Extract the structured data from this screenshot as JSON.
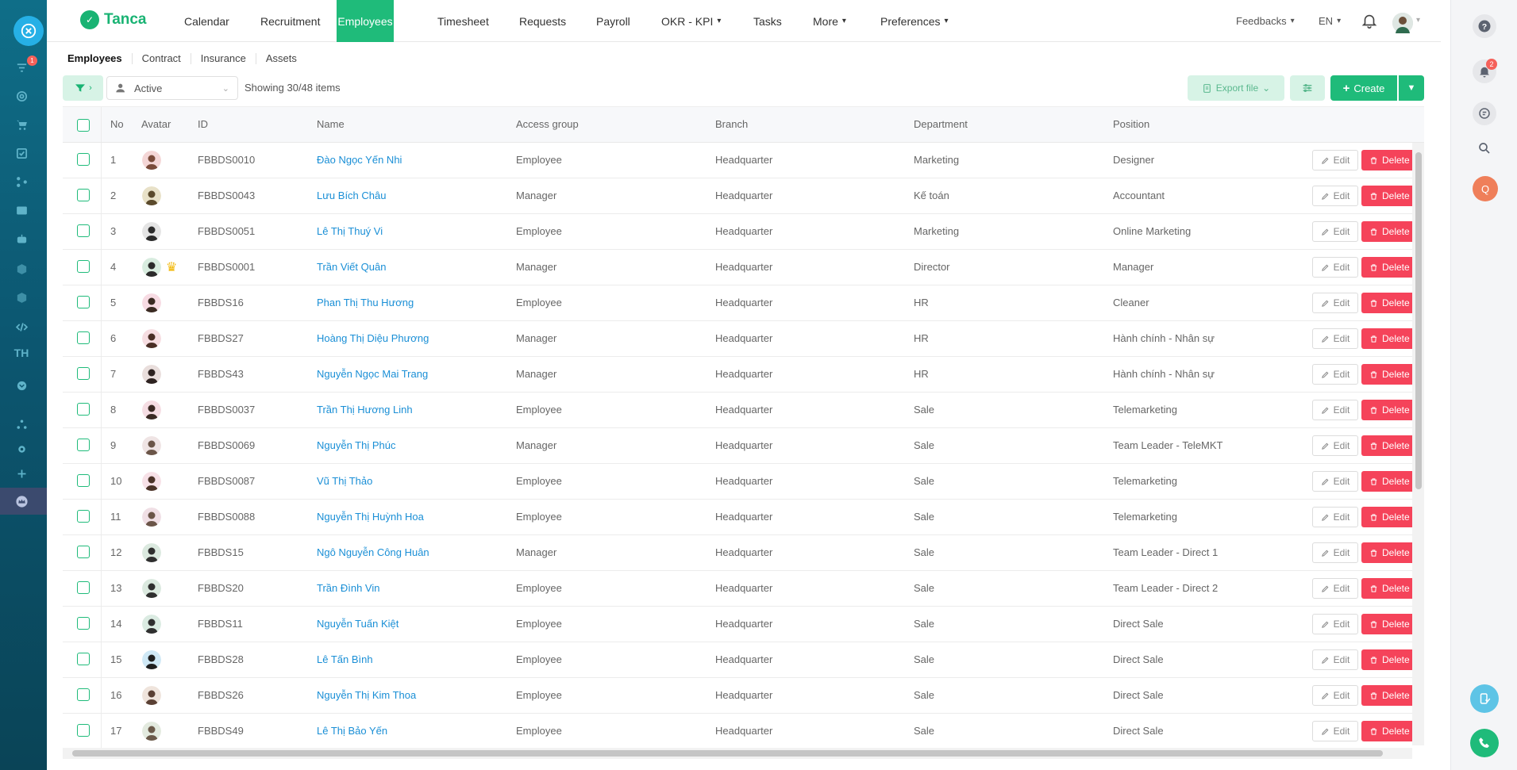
{
  "app": {
    "logo_text": "Tanca"
  },
  "nav": {
    "items": [
      {
        "label": "Calendar"
      },
      {
        "label": "Recruitment"
      },
      {
        "label": "Employees",
        "active": true
      },
      {
        "label": "Timesheet"
      },
      {
        "label": "Requests"
      },
      {
        "label": "Payroll"
      },
      {
        "label": "OKR - KPI",
        "dropdown": true
      },
      {
        "label": "Tasks"
      },
      {
        "label": "More",
        "dropdown": true
      },
      {
        "label": "Preferences",
        "dropdown": true
      }
    ],
    "feedbacks": "Feedbacks",
    "language": "EN"
  },
  "leftbar": {
    "badge": "1",
    "text_icon": "TH"
  },
  "rightbar": {
    "notification_badge": "2",
    "avatar_letter": "Q"
  },
  "subtabs": [
    "Employees",
    "Contract",
    "Insurance",
    "Assets"
  ],
  "toolbar": {
    "status_value": "Active",
    "showing": "Showing 30/48 items",
    "export_label": "Export file",
    "create_label": "Create"
  },
  "table": {
    "headers": {
      "no": "No",
      "avatar": "Avatar",
      "id": "ID",
      "name": "Name",
      "access_group": "Access group",
      "branch": "Branch",
      "department": "Department",
      "position": "Position"
    },
    "edit_label": "Edit",
    "delete_label": "Delete",
    "rows": [
      {
        "no": "1",
        "id": "FBBDS0010",
        "name": "Đào Ngọc Yến Nhi",
        "access": "Employee",
        "branch": "Headquarter",
        "dept": "Marketing",
        "position": "Designer"
      },
      {
        "no": "2",
        "id": "FBBDS0043",
        "name": "Lưu Bích Châu",
        "access": "Manager",
        "branch": "Headquarter",
        "dept": "Kế toán",
        "position": "Accountant"
      },
      {
        "no": "3",
        "id": "FBBDS0051",
        "name": "Lê Thị Thuý Vi",
        "access": "Employee",
        "branch": "Headquarter",
        "dept": "Marketing",
        "position": "Online Marketing"
      },
      {
        "no": "4",
        "id": "FBBDS0001",
        "name": "Trần Viết Quân",
        "access": "Manager",
        "branch": "Headquarter",
        "dept": "Director",
        "position": "Manager",
        "crown": true
      },
      {
        "no": "5",
        "id": "FBBDS16",
        "name": "Phan Thị Thu Hương",
        "access": "Employee",
        "branch": "Headquarter",
        "dept": "HR",
        "position": "Cleaner"
      },
      {
        "no": "6",
        "id": "FBBDS27",
        "name": "Hoàng Thị Diệu Phương",
        "access": "Manager",
        "branch": "Headquarter",
        "dept": "HR",
        "position": "Hành chính - Nhân sự"
      },
      {
        "no": "7",
        "id": "FBBDS43",
        "name": "Nguyễn Ngọc Mai Trang",
        "access": "Manager",
        "branch": "Headquarter",
        "dept": "HR",
        "position": "Hành chính - Nhân sự"
      },
      {
        "no": "8",
        "id": "FBBDS0037",
        "name": "Trần Thị Hương Linh",
        "access": "Employee",
        "branch": "Headquarter",
        "dept": "Sale",
        "position": "Telemarketing"
      },
      {
        "no": "9",
        "id": "FBBDS0069",
        "name": "Nguyễn Thị Phúc",
        "access": "Manager",
        "branch": "Headquarter",
        "dept": "Sale",
        "position": "Team Leader - TeleMKT"
      },
      {
        "no": "10",
        "id": "FBBDS0087",
        "name": "Vũ Thị Thảo",
        "access": "Employee",
        "branch": "Headquarter",
        "dept": "Sale",
        "position": "Telemarketing"
      },
      {
        "no": "11",
        "id": "FBBDS0088",
        "name": "Nguyễn Thị Huỳnh Hoa",
        "access": "Employee",
        "branch": "Headquarter",
        "dept": "Sale",
        "position": "Telemarketing"
      },
      {
        "no": "12",
        "id": "FBBDS15",
        "name": "Ngô Nguyễn Công Huân",
        "access": "Manager",
        "branch": "Headquarter",
        "dept": "Sale",
        "position": "Team Leader - Direct 1"
      },
      {
        "no": "13",
        "id": "FBBDS20",
        "name": "Trần Đình Vin",
        "access": "Employee",
        "branch": "Headquarter",
        "dept": "Sale",
        "position": "Team Leader - Direct 2"
      },
      {
        "no": "14",
        "id": "FBBDS11",
        "name": "Nguyễn Tuấn Kiệt",
        "access": "Employee",
        "branch": "Headquarter",
        "dept": "Sale",
        "position": "Direct Sale"
      },
      {
        "no": "15",
        "id": "FBBDS28",
        "name": "Lê Tấn Bình",
        "access": "Employee",
        "branch": "Headquarter",
        "dept": "Sale",
        "position": "Direct Sale"
      },
      {
        "no": "16",
        "id": "FBBDS26",
        "name": "Nguyễn Thị Kim Thoa",
        "access": "Employee",
        "branch": "Headquarter",
        "dept": "Sale",
        "position": "Direct Sale"
      },
      {
        "no": "17",
        "id": "FBBDS49",
        "name": "Lê Thị Bảo Yến",
        "access": "Employee",
        "branch": "Headquarter",
        "dept": "Sale",
        "position": "Direct Sale"
      }
    ]
  }
}
